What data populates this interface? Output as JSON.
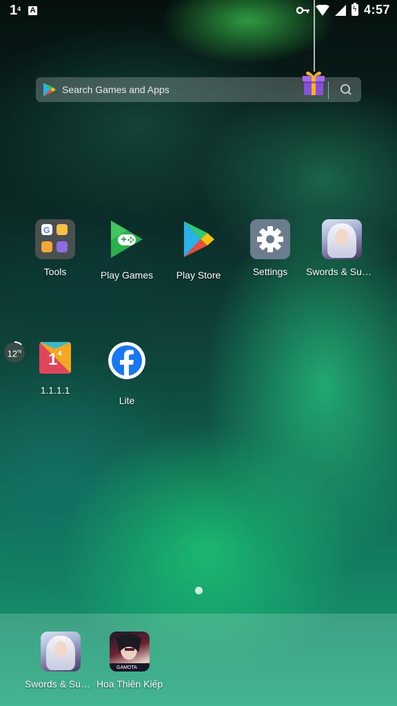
{
  "status_bar": {
    "left_badge_number": "1",
    "left_badge_superscript": "4",
    "notification_icon_letter": "A",
    "time": "4:57",
    "icons": [
      "vpn-key-icon",
      "wifi-icon",
      "signal-icon",
      "battery-charging-icon"
    ]
  },
  "search": {
    "placeholder": "Search Games and Apps",
    "icons": [
      "play-store-logo-icon",
      "gift-icon",
      "search-icon"
    ]
  },
  "home_apps_row1": [
    {
      "label": "Tools",
      "icon": "tools-folder-icon"
    },
    {
      "label": "Play Games",
      "icon": "play-games-icon"
    },
    {
      "label": "Play Store",
      "icon": "play-store-icon"
    },
    {
      "label": "Settings",
      "icon": "settings-gear-icon"
    },
    {
      "label": "Swords & Sum...",
      "icon": "swords-summoners-icon"
    }
  ],
  "home_apps_row2": [
    {
      "label": "1.1.1.1",
      "icon": "cloudflare-1111-icon"
    },
    {
      "label": "Lite",
      "icon": "facebook-lite-icon"
    }
  ],
  "memory_widget": {
    "value": "12",
    "unit": "%",
    "percent": 12
  },
  "page_indicator": {
    "pages": 1,
    "current": 1
  },
  "dock": [
    {
      "label": "Swords & Sum...",
      "icon": "swords-summoners-icon"
    },
    {
      "label": "Hoa Thiên Kiếp",
      "icon": "hoa-thien-kiep-icon"
    }
  ],
  "colors": {
    "accent_green": "#1fd28a",
    "gift_purple": "#8a4fd8",
    "gift_ribbon": "#f5b325",
    "play_games_green": "#2bb14c",
    "facebook_blue": "#1877f2"
  }
}
